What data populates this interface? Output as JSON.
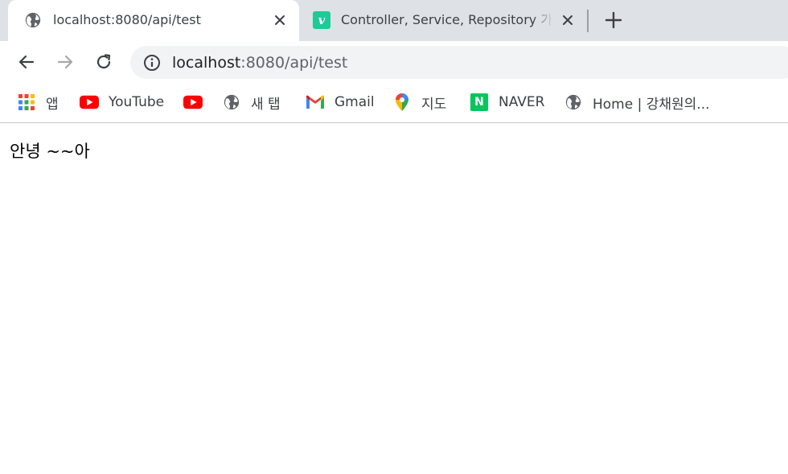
{
  "tabs": [
    {
      "title": "localhost:8080/api/test",
      "favicon": "globe-icon",
      "active": true
    },
    {
      "title": "Controller, Service, Repository 가",
      "favicon": "velog-v-icon",
      "logo_letter": "v",
      "active": false
    }
  ],
  "toolbar": {
    "url_host": "localhost",
    "url_rest": ":8080/api/test"
  },
  "bookmarks": [
    {
      "label": "앱",
      "icon": "apps-grid-icon"
    },
    {
      "label": "YouTube",
      "icon": "youtube-icon"
    },
    {
      "label": "",
      "icon": "youtube-icon"
    },
    {
      "label": "새 탭",
      "icon": "globe-icon"
    },
    {
      "label": "Gmail",
      "icon": "gmail-icon"
    },
    {
      "label": "지도",
      "icon": "maps-pin-icon"
    },
    {
      "label": "NAVER",
      "icon": "naver-icon",
      "logo_letter": "N"
    },
    {
      "label": "Home | 강채원의...",
      "icon": "globe-icon"
    }
  ],
  "content": {
    "text": "안녕 ~~아"
  },
  "colors": {
    "tabstrip_bg": "#dee1e6",
    "omnibox_bg": "#f1f3f4",
    "youtube_red": "#ff0000",
    "naver_green": "#03c75a",
    "velog_green": "#20c997"
  }
}
